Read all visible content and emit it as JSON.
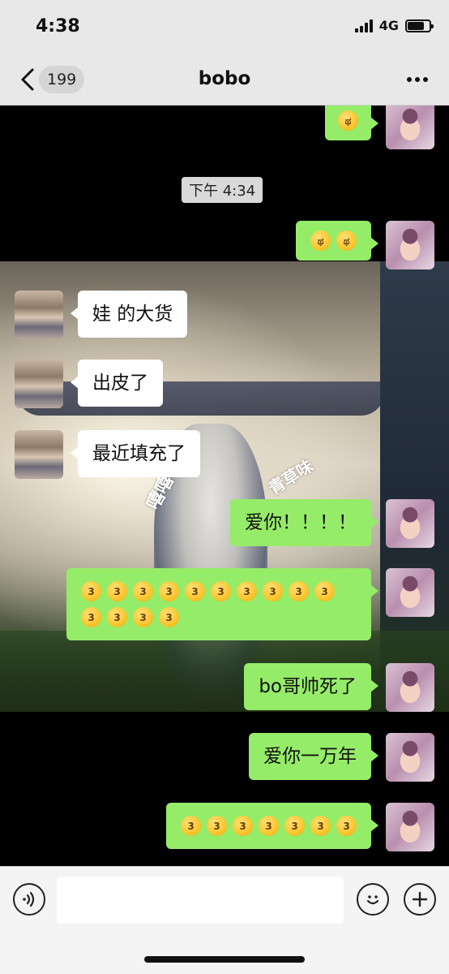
{
  "status_bar": {
    "time": "4:38",
    "network": "4G",
    "battery_level": 0.75
  },
  "header": {
    "unread_count": "199",
    "title": "bobo"
  },
  "chat": {
    "overlay_texts": [
      "嘻嘻嘻",
      "青草味"
    ],
    "timestamp": "下午 4:34",
    "messages": [
      {
        "from": "me",
        "kind": "emoji",
        "emoji": [
          "crying-face-emoji"
        ]
      },
      {
        "from": "me",
        "kind": "emoji",
        "emoji": [
          "crying-face-emoji",
          "crying-face-emoji"
        ]
      },
      {
        "from": "them",
        "kind": "text",
        "text": "娃 的大货"
      },
      {
        "from": "them",
        "kind": "text",
        "text": "出皮了"
      },
      {
        "from": "them",
        "kind": "text",
        "text": "最近填充了"
      },
      {
        "from": "me",
        "kind": "text",
        "text": "爱你！！！！"
      },
      {
        "from": "me",
        "kind": "emoji",
        "emoji_count": 14,
        "emoji_name": "kissing-face-emoji"
      },
      {
        "from": "me",
        "kind": "text",
        "text": "bo哥帅死了"
      },
      {
        "from": "me",
        "kind": "text",
        "text": "爱你一万年"
      },
      {
        "from": "me",
        "kind": "emoji",
        "emoji_count": 7,
        "emoji_name": "kissing-face-emoji"
      }
    ]
  },
  "input_bar": {
    "placeholder": "",
    "voice_icon": "voice-icon",
    "emoji_icon": "smiley-icon",
    "add_icon": "plus-icon"
  },
  "colors": {
    "my_bubble": "#95ec69",
    "their_bubble": "#ffffff",
    "header_bg": "#e8e8e8"
  }
}
